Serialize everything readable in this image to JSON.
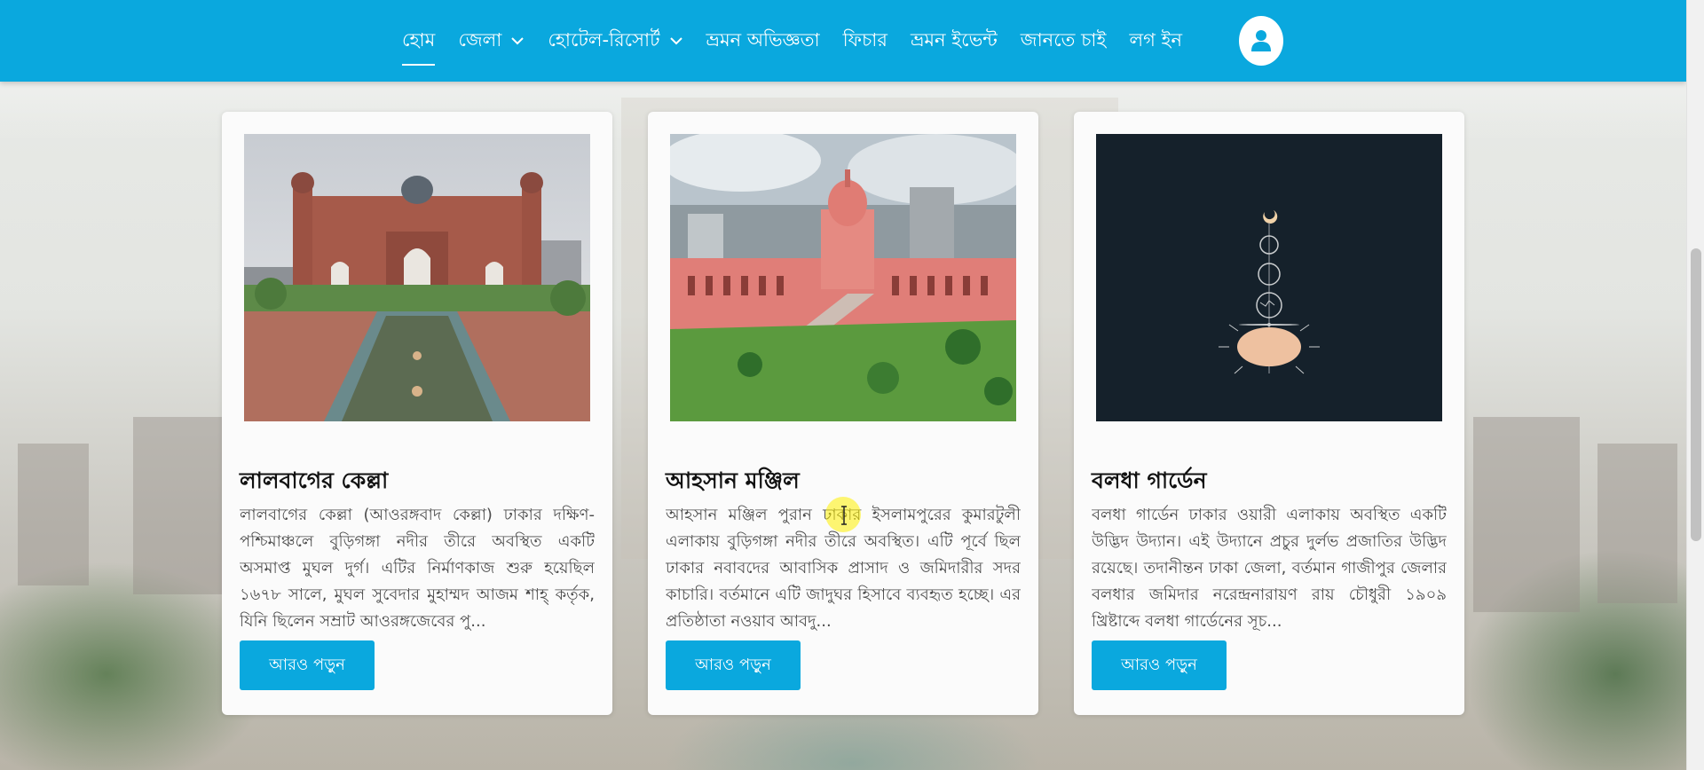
{
  "nav": {
    "items": [
      {
        "label": "হোম",
        "active": true,
        "dropdown": false
      },
      {
        "label": "জেলা",
        "active": false,
        "dropdown": true
      },
      {
        "label": "হোটেল-রিসোর্ট",
        "active": false,
        "dropdown": true
      },
      {
        "label": "ভ্রমন অভিজ্ঞতা",
        "active": false,
        "dropdown": false
      },
      {
        "label": "ফিচার",
        "active": false,
        "dropdown": false
      },
      {
        "label": "ভ্রমন ইভেন্ট",
        "active": false,
        "dropdown": false
      },
      {
        "label": "জানতে চাই",
        "active": false,
        "dropdown": false
      },
      {
        "label": "লগ ইন",
        "active": false,
        "dropdown": false
      }
    ],
    "avatar_icon": "user-icon"
  },
  "colors": {
    "brand": "#0aa8de",
    "card_bg": "#fbfbfb",
    "title": "#111111",
    "body_text": "#4b4b4b"
  },
  "cards": [
    {
      "title": "লালবাগের কেল্লা",
      "text": "লালবাগের কেল্লা (আওরঙ্গবাদ কেল্লা) ঢাকার দক্ষিণ-পশ্চিমাঞ্চলে বুড়িগঙ্গা নদীর তীরে অবস্থিত একটি অসমাপ্ত মুঘল দুর্গ। এটির নির্মাণকাজ শুরু হয়েছিল ১৬৭৮ সালে, মুঘল সুবেদার মুহাম্মদ আজম শাহ্‌ কর্তৃক, যিনি ছিলেন সম্রাট আওরঙ্গজেবের পু...",
      "button": "আরও পড়ুন",
      "image": "lalbagh-fort-photo"
    },
    {
      "title": "আহসান মঞ্জিল",
      "text": "আহসান মঞ্জিল পুরান ঢাকার ইসলামপুরের কুমারটুলী এলাকায় বুড়িগঙ্গা নদীর তীরে অবস্থিত। এটি পূর্বে ছিল ঢাকার নবাবদের আবাসিক প্রাসাদ ও জমিদারীর সদর কাচারি। বর্তমানে এটি জাদুঘর হিসাবে ব্যবহৃত হচ্ছে। এর প্রতিষ্ঠাতা নওয়াব আবদু...",
      "button": "আরও পড়ুন",
      "image": "ahsan-manzil-photo"
    },
    {
      "title": "বলধা গার্ডেন",
      "text": "বলধা গার্ডেন ঢাকার ওয়ারী এলাকায় অবস্থিত একটি উদ্ভিদ উদ্যান। এই উদ্যানে প্রচুর দুর্লভ প্রজাতির উদ্ভিদ রয়েছে। তদানীন্তন ঢাকা জেলা, বর্তমান গাজীপুর জেলার বলধার জমিদার নরেন্দ্রনারায়ণ রায় চৌধুরী ১৯০৯ খ্রিষ্টাব্দে বলধা গার্ডেনের সূচ...",
      "button": "আরও পড়ুন",
      "image": "moon-phases-illustration"
    }
  ]
}
